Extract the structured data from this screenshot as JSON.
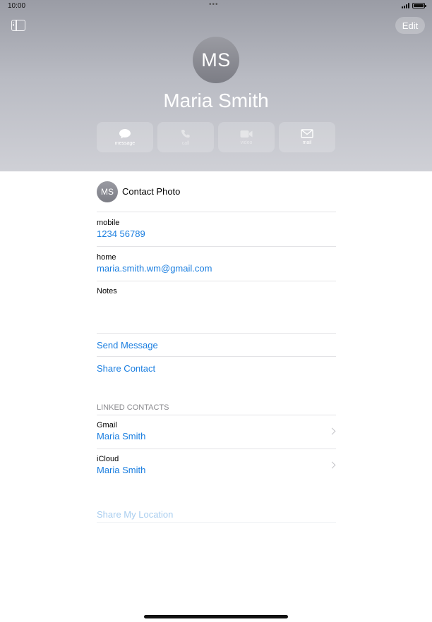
{
  "status_bar": {
    "time": "10:00",
    "dots": "•••"
  },
  "header": {
    "edit_label": "Edit",
    "initials": "MS",
    "name": "Maria Smith",
    "actions": [
      {
        "label": "message",
        "icon": "message-bubble-icon",
        "enabled": true
      },
      {
        "label": "call",
        "icon": "phone-icon",
        "enabled": false
      },
      {
        "label": "video",
        "icon": "video-camera-icon",
        "enabled": false
      },
      {
        "label": "mail",
        "icon": "envelope-icon",
        "enabled": true
      }
    ]
  },
  "details": {
    "photo": {
      "initials": "MS",
      "label": "Contact Photo"
    },
    "phone": {
      "label": "mobile",
      "value": "1234 56789"
    },
    "email": {
      "label": "home",
      "value": "maria.smith.wm@gmail.com"
    },
    "notes": {
      "label": "Notes"
    },
    "links": [
      "Send Message",
      "Share Contact"
    ],
    "linked_header": "LINKED CONTACTS",
    "linked": [
      {
        "source": "Gmail",
        "name": "Maria Smith"
      },
      {
        "source": "iCloud",
        "name": "Maria Smith"
      }
    ],
    "share_location": "Share My Location"
  },
  "colors": {
    "accent": "#1a7ee0",
    "header_top": "#9a9ca5",
    "header_bottom": "#cfd0d6"
  }
}
